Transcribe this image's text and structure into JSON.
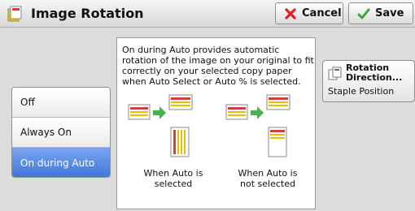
{
  "header": {
    "title": "Image Rotation",
    "cancel_label": "Cancel",
    "save_label": "Save"
  },
  "options": {
    "items": [
      {
        "label": "Off"
      },
      {
        "label": "Always On"
      },
      {
        "label": "On during Auto"
      }
    ],
    "selected": "On during Auto"
  },
  "info": {
    "description": "On during Auto provides automatic rotation of the image on your original to fit correctly on your selected copy paper when Auto Select or Auto % is selected.",
    "caption_auto": "When Auto is selected",
    "caption_not_auto": "When Auto is not selected"
  },
  "side": {
    "button_label_line1": "Rotation",
    "button_label_line2": "Direction...",
    "staple_position": "Staple Position"
  },
  "colors": {
    "accent": "#3f76d8",
    "cancel_icon": "#e02020",
    "save_icon": "#3ca53c"
  }
}
